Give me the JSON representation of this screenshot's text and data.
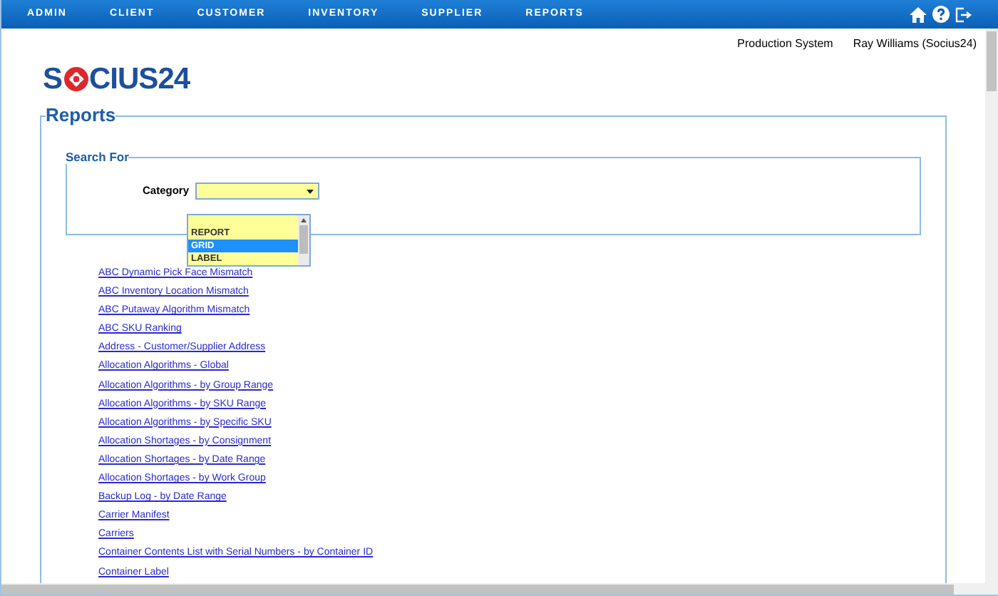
{
  "nav": {
    "menu": [
      "ADMIN",
      "CLIENT",
      "CUSTOMER",
      "INVENTORY",
      "SUPPLIER",
      "REPORTS"
    ]
  },
  "header": {
    "system": "Production System",
    "user": "Ray Williams (Socius24)",
    "logo_left": "S",
    "logo_right": "CIUS24"
  },
  "reports": {
    "title": "Reports",
    "search": {
      "title": "Search For",
      "category_label": "Category",
      "dropdown_open": true,
      "options": [
        {
          "selected": false
        },
        {
          "label": "REPORT",
          "selected": false
        },
        {
          "label": "GRID",
          "selected": true
        },
        {
          "label": "LABEL",
          "selected": false
        }
      ]
    },
    "links": [
      "ABC Dynamic Pick Face Mismatch",
      "ABC Inventory Location Mismatch",
      "ABC Putaway Algorithm Mismatch",
      "ABC SKU Ranking",
      "Address - Customer/Supplier Address",
      "Allocation Algorithms - Global",
      "Allocation Algorithms - by Group Range",
      "Allocation Algorithms - by SKU Range",
      "Allocation Algorithms - by Specific SKU",
      "Allocation Shortages - by Consignment",
      "Allocation Shortages - by Date Range",
      "Allocation Shortages - by Work Group",
      "Backup Log - by Date Range",
      "Carrier Manifest",
      "Carriers",
      "Container Contents List with Serial Numbers - by Container ID",
      "Container Label"
    ]
  }
}
